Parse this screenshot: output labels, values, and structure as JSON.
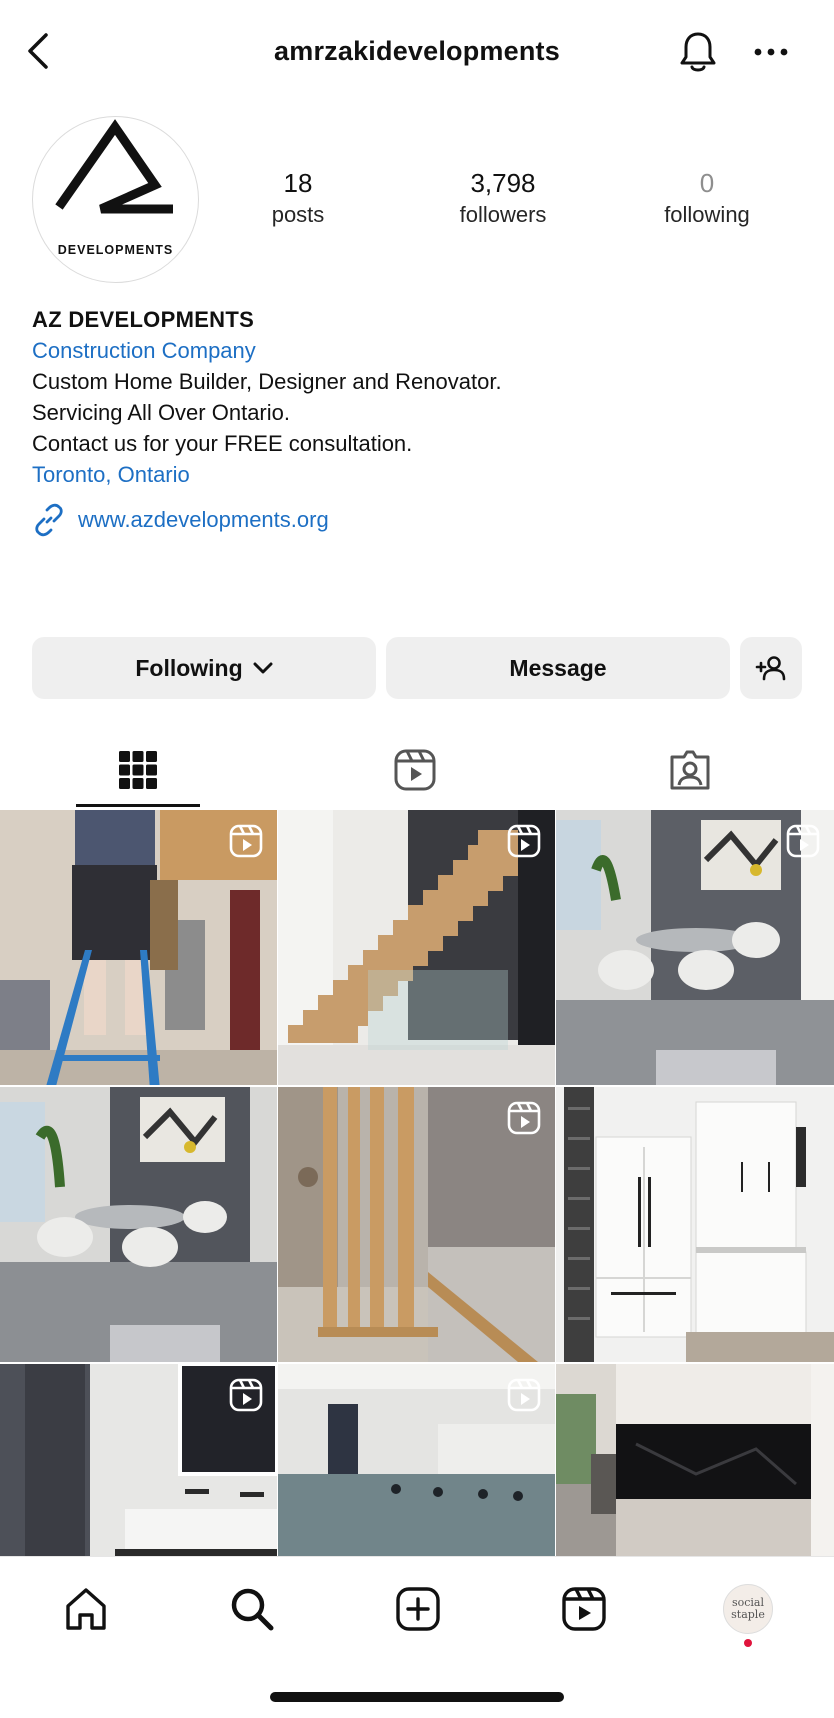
{
  "header": {
    "username": "amrzakidevelopments",
    "back_icon": "chevron-left-icon",
    "bell_icon": "bell-icon",
    "more_icon": "more-horizontal-icon"
  },
  "profile": {
    "avatar_logo_text": "DEVELOPMENTS",
    "stats": {
      "posts": {
        "value": "18",
        "label": "posts"
      },
      "followers": {
        "value": "3,798",
        "label": "followers"
      },
      "following": {
        "value": "0",
        "label": "following"
      }
    }
  },
  "bio": {
    "name": "AZ DEVELOPMENTS",
    "category": "Construction Company",
    "lines": [
      "Custom Home Builder, Designer and Renovator.",
      "Servicing All Over Ontario.",
      "Contact us for your FREE consultation."
    ],
    "location": "Toronto, Ontario",
    "website": "www.azdevelopments.org"
  },
  "actions": {
    "following_label": "Following",
    "message_label": "Message"
  },
  "tabs": [
    {
      "name": "grid",
      "icon": "grid-icon",
      "active": true
    },
    {
      "name": "reels",
      "icon": "reels-icon",
      "active": false
    },
    {
      "name": "tagged",
      "icon": "tagged-user-icon",
      "active": false
    }
  ],
  "posts": [
    {
      "subject": "worker on ladder renovation",
      "reel": true
    },
    {
      "subject": "floating wood staircase",
      "reel": true
    },
    {
      "subject": "dining room with artwork",
      "reel": true
    },
    {
      "subject": "dining room",
      "reel": false
    },
    {
      "subject": "wood framing",
      "reel": true
    },
    {
      "subject": "white kitchen cabinets",
      "reel": false
    },
    {
      "subject": "bathroom vanity",
      "reel": true
    },
    {
      "subject": "glass railing",
      "reel": true
    },
    {
      "subject": "kitchen black backsplash",
      "reel": false
    }
  ],
  "bottom_nav": {
    "items": [
      "home-icon",
      "search-icon",
      "create-icon",
      "reels-icon",
      "profile-avatar"
    ],
    "avatar_text_1": "social",
    "avatar_text_2": "staple"
  }
}
